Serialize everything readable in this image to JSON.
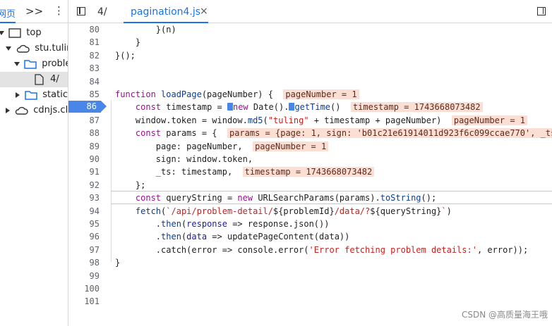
{
  "navigator": {
    "tab_label": "网页",
    "more_icon": ">>",
    "menu_icon": "⋮",
    "tree": [
      {
        "label": "top",
        "icon": "frame-icon",
        "expanded": true
      },
      {
        "label": "stu.tuling",
        "icon": "cloud-icon",
        "expanded": true
      },
      {
        "label": "proble",
        "icon": "folder-icon",
        "expanded": true
      },
      {
        "label": "4/",
        "icon": "file-icon"
      },
      {
        "label": "static",
        "icon": "folder-icon",
        "expanded": false
      },
      {
        "label": "cdnjs.clo",
        "icon": "cloud-icon",
        "expanded": false
      }
    ]
  },
  "editor": {
    "tabs": [
      {
        "label": "4/",
        "active": false
      },
      {
        "label": "pagination4.js",
        "active": true,
        "close": "×"
      }
    ],
    "current_line": "86",
    "line_numbers": [
      "80",
      "81",
      "82",
      "83",
      "84",
      "85",
      "86",
      "87",
      "88",
      "89",
      "90",
      "91",
      "92",
      "93",
      "94",
      "95",
      "96",
      "97",
      "98",
      "99",
      "100",
      "101"
    ]
  },
  "watermark": "CSDN @高质量海王哦"
}
